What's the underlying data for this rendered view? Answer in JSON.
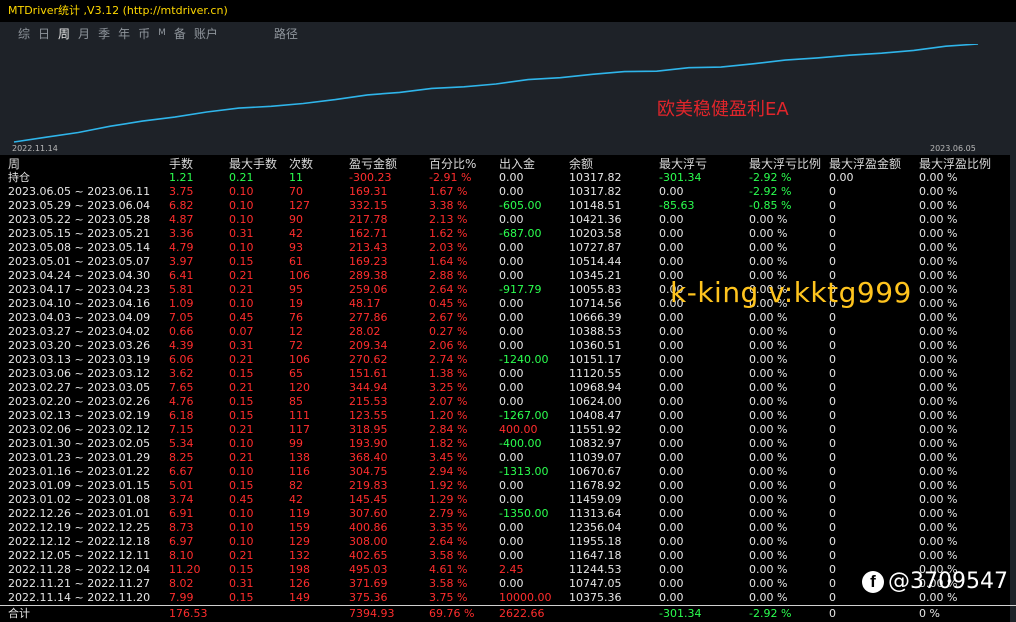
{
  "window": {
    "title": "MTDriver统计 ,V3.12 (http://mtdriver.cn)"
  },
  "tabs": [
    {
      "label": "综",
      "active": false,
      "small": false
    },
    {
      "label": "日",
      "active": false,
      "small": false
    },
    {
      "label": "周",
      "active": true,
      "small": false
    },
    {
      "label": "月",
      "active": false,
      "small": false
    },
    {
      "label": "季",
      "active": false,
      "small": false
    },
    {
      "label": "年",
      "active": false,
      "small": false
    },
    {
      "label": "币",
      "active": false,
      "small": false
    },
    {
      "label": "M",
      "active": false,
      "small": true
    },
    {
      "label": "备",
      "active": false,
      "small": false
    },
    {
      "label": "账户",
      "active": false,
      "small": false
    }
  ],
  "path_label": "路径",
  "chart": {
    "start_date": "2022.11.14",
    "end_date": "2023.06.05",
    "line_color": "#2fb5ea",
    "watermark_ea": "欧美稳健盈利EA",
    "balances": [
      10375.36,
      10747.05,
      11244.53,
      11647.18,
      11955.18,
      12356.04,
      11313.64,
      11459.09,
      11678.92,
      10670.67,
      11039.07,
      10832.97,
      11551.92,
      10408.47,
      10624.0,
      10968.94,
      11120.55,
      10151.17,
      10360.51,
      10388.53,
      10666.39,
      10714.56,
      10055.83,
      10345.21,
      10514.44,
      10727.87,
      10203.58,
      10421.36,
      10148.51,
      10317.82
    ]
  },
  "table": {
    "headers": [
      "周",
      "手数",
      "最大手数",
      "次数",
      "盈亏金额",
      "百分比%",
      "出入金",
      "余额",
      "最大浮亏",
      "最大浮亏比例",
      "最大浮盈金额",
      "最大浮盈比例"
    ],
    "position_row": {
      "label": "持仓",
      "cells": [
        "1.21",
        "0.21",
        "11",
        "-300.23",
        "-2.91 %",
        "0.00",
        "10317.82",
        "-301.34",
        "-2.92 %",
        "0.00",
        "0.00 %"
      ]
    },
    "rows": [
      [
        "2023.06.05 ~ 2023.06.11",
        "3.75",
        "0.10",
        "70",
        "169.31",
        "1.67 %",
        "0.00",
        "10317.82",
        "0.00",
        "-2.92 %",
        "0",
        "0.00 %"
      ],
      [
        "2023.05.29 ~ 2023.06.04",
        "6.82",
        "0.10",
        "127",
        "332.15",
        "3.38 %",
        "-605.00",
        "10148.51",
        "-85.63",
        "-0.85 %",
        "0",
        "0.00 %"
      ],
      [
        "2023.05.22 ~ 2023.05.28",
        "4.87",
        "0.10",
        "90",
        "217.78",
        "2.13 %",
        "0.00",
        "10421.36",
        "0.00",
        "0.00 %",
        "0",
        "0.00 %"
      ],
      [
        "2023.05.15 ~ 2023.05.21",
        "3.36",
        "0.31",
        "42",
        "162.71",
        "1.62 %",
        "-687.00",
        "10203.58",
        "0.00",
        "0.00 %",
        "0",
        "0.00 %"
      ],
      [
        "2023.05.08 ~ 2023.05.14",
        "4.79",
        "0.10",
        "93",
        "213.43",
        "2.03 %",
        "0.00",
        "10727.87",
        "0.00",
        "0.00 %",
        "0",
        "0.00 %"
      ],
      [
        "2023.05.01 ~ 2023.05.07",
        "3.97",
        "0.15",
        "61",
        "169.23",
        "1.64 %",
        "0.00",
        "10514.44",
        "0.00",
        "0.00 %",
        "0",
        "0.00 %"
      ],
      [
        "2023.04.24 ~ 2023.04.30",
        "6.41",
        "0.21",
        "106",
        "289.38",
        "2.88 %",
        "0.00",
        "10345.21",
        "0.00",
        "0.00 %",
        "0",
        "0.00 %"
      ],
      [
        "2023.04.17 ~ 2023.04.23",
        "5.81",
        "0.21",
        "95",
        "259.06",
        "2.64 %",
        "-917.79",
        "10055.83",
        "0.00",
        "0.00 %",
        "0",
        "0.00 %"
      ],
      [
        "2023.04.10 ~ 2023.04.16",
        "1.09",
        "0.10",
        "19",
        "48.17",
        "0.45 %",
        "0.00",
        "10714.56",
        "0.00",
        "0.00 %",
        "0",
        "0.00 %"
      ],
      [
        "2023.04.03 ~ 2023.04.09",
        "7.05",
        "0.45",
        "76",
        "277.86",
        "2.67 %",
        "0.00",
        "10666.39",
        "0.00",
        "0.00 %",
        "0",
        "0.00 %"
      ],
      [
        "2023.03.27 ~ 2023.04.02",
        "0.66",
        "0.07",
        "12",
        "28.02",
        "0.27 %",
        "0.00",
        "10388.53",
        "0.00",
        "0.00 %",
        "0",
        "0.00 %"
      ],
      [
        "2023.03.20 ~ 2023.03.26",
        "4.39",
        "0.31",
        "72",
        "209.34",
        "2.06 %",
        "0.00",
        "10360.51",
        "0.00",
        "0.00 %",
        "0",
        "0.00 %"
      ],
      [
        "2023.03.13 ~ 2023.03.19",
        "6.06",
        "0.21",
        "106",
        "270.62",
        "2.74 %",
        "-1240.00",
        "10151.17",
        "0.00",
        "0.00 %",
        "0",
        "0.00 %"
      ],
      [
        "2023.03.06 ~ 2023.03.12",
        "3.62",
        "0.15",
        "65",
        "151.61",
        "1.38 %",
        "0.00",
        "11120.55",
        "0.00",
        "0.00 %",
        "0",
        "0.00 %"
      ],
      [
        "2023.02.27 ~ 2023.03.05",
        "7.65",
        "0.21",
        "120",
        "344.94",
        "3.25 %",
        "0.00",
        "10968.94",
        "0.00",
        "0.00 %",
        "0",
        "0.00 %"
      ],
      [
        "2023.02.20 ~ 2023.02.26",
        "4.76",
        "0.15",
        "85",
        "215.53",
        "2.07 %",
        "0.00",
        "10624.00",
        "0.00",
        "0.00 %",
        "0",
        "0.00 %"
      ],
      [
        "2023.02.13 ~ 2023.02.19",
        "6.18",
        "0.15",
        "111",
        "123.55",
        "1.20 %",
        "-1267.00",
        "10408.47",
        "0.00",
        "0.00 %",
        "0",
        "0.00 %"
      ],
      [
        "2023.02.06 ~ 2023.02.12",
        "7.15",
        "0.21",
        "117",
        "318.95",
        "2.84 %",
        "400.00",
        "11551.92",
        "0.00",
        "0.00 %",
        "0",
        "0.00 %"
      ],
      [
        "2023.01.30 ~ 2023.02.05",
        "5.34",
        "0.10",
        "99",
        "193.90",
        "1.82 %",
        "-400.00",
        "10832.97",
        "0.00",
        "0.00 %",
        "0",
        "0.00 %"
      ],
      [
        "2023.01.23 ~ 2023.01.29",
        "8.25",
        "0.21",
        "138",
        "368.40",
        "3.45 %",
        "0.00",
        "11039.07",
        "0.00",
        "0.00 %",
        "0",
        "0.00 %"
      ],
      [
        "2023.01.16 ~ 2023.01.22",
        "6.67",
        "0.10",
        "116",
        "304.75",
        "2.94 %",
        "-1313.00",
        "10670.67",
        "0.00",
        "0.00 %",
        "0",
        "0.00 %"
      ],
      [
        "2023.01.09 ~ 2023.01.15",
        "5.01",
        "0.15",
        "82",
        "219.83",
        "1.92 %",
        "0.00",
        "11678.92",
        "0.00",
        "0.00 %",
        "0",
        "0.00 %"
      ],
      [
        "2023.01.02 ~ 2023.01.08",
        "3.74",
        "0.45",
        "42",
        "145.45",
        "1.29 %",
        "0.00",
        "11459.09",
        "0.00",
        "0.00 %",
        "0",
        "0.00 %"
      ],
      [
        "2022.12.26 ~ 2023.01.01",
        "6.91",
        "0.10",
        "119",
        "307.60",
        "2.79 %",
        "-1350.00",
        "11313.64",
        "0.00",
        "0.00 %",
        "0",
        "0.00 %"
      ],
      [
        "2022.12.19 ~ 2022.12.25",
        "8.73",
        "0.10",
        "159",
        "400.86",
        "3.35 %",
        "0.00",
        "12356.04",
        "0.00",
        "0.00 %",
        "0",
        "0.00 %"
      ],
      [
        "2022.12.12 ~ 2022.12.18",
        "6.97",
        "0.10",
        "129",
        "308.00",
        "2.64 %",
        "0.00",
        "11955.18",
        "0.00",
        "0.00 %",
        "0",
        "0.00 %"
      ],
      [
        "2022.12.05 ~ 2022.12.11",
        "8.10",
        "0.21",
        "132",
        "402.65",
        "3.58 %",
        "0.00",
        "11647.18",
        "0.00",
        "0.00 %",
        "0",
        "0.00 %"
      ],
      [
        "2022.11.28 ~ 2022.12.04",
        "11.20",
        "0.15",
        "198",
        "495.03",
        "4.61 %",
        "2.45",
        "11244.53",
        "0.00",
        "0.00 %",
        "0",
        "0.00 %"
      ],
      [
        "2022.11.21 ~ 2022.11.27",
        "8.02",
        "0.31",
        "126",
        "371.69",
        "3.58 %",
        "0.00",
        "10747.05",
        "0.00",
        "0.00 %",
        "0",
        "0.00 %"
      ],
      [
        "2022.11.14 ~ 2022.11.20",
        "7.99",
        "0.15",
        "149",
        "375.36",
        "3.75 %",
        "10000.00",
        "10375.36",
        "0.00",
        "0.00 %",
        "0",
        "0.00 %"
      ]
    ],
    "total_row": {
      "label": "合计",
      "cells": [
        "176.53",
        "",
        "",
        "7394.93",
        "69.76 %",
        "2622.66",
        "",
        "-301.34",
        "-2.92 %",
        "0",
        "0 %"
      ]
    }
  },
  "watermarks": {
    "contact": "k-king   v:kktg999",
    "social_handle": "@3709547",
    "social_icon": "facebook-icon"
  }
}
